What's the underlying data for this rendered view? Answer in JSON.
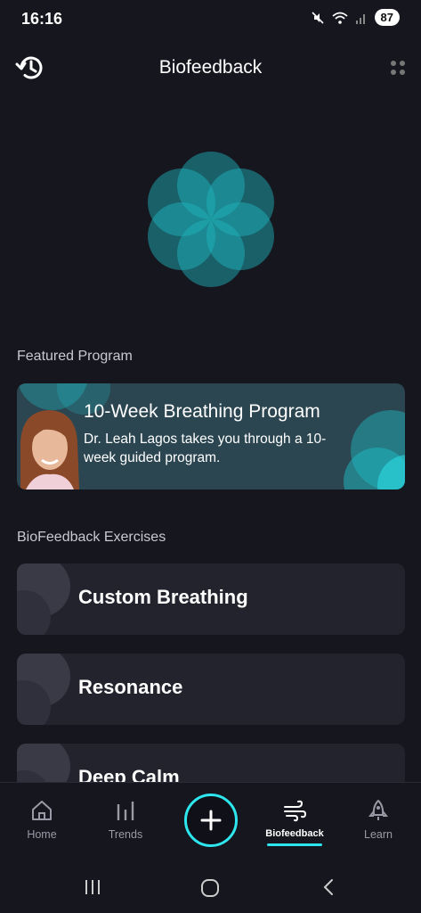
{
  "status_bar": {
    "time": "16:16",
    "battery": "87"
  },
  "header": {
    "title": "Biofeedback"
  },
  "featured": {
    "section_label": "Featured Program",
    "title": "10-Week Breathing Program",
    "description": "Dr. Leah Lagos takes you through a 10-week guided program."
  },
  "exercises": {
    "section_label": "BioFeedback Exercises",
    "items": [
      {
        "label": "Custom Breathing"
      },
      {
        "label": "Resonance"
      },
      {
        "label": "Deep Calm"
      }
    ]
  },
  "bottom_nav": {
    "items": [
      {
        "label": "Home",
        "icon": "home-icon"
      },
      {
        "label": "Trends",
        "icon": "trends-icon"
      },
      {
        "label": "Biofeedback",
        "icon": "wind-icon",
        "active": true
      },
      {
        "label": "Learn",
        "icon": "rocket-icon"
      }
    ],
    "fab_icon": "plus-icon"
  },
  "colors": {
    "accent": "#2ee6ee",
    "background": "#16161f",
    "card": "#23232e",
    "featured_card": "#2b4651"
  }
}
